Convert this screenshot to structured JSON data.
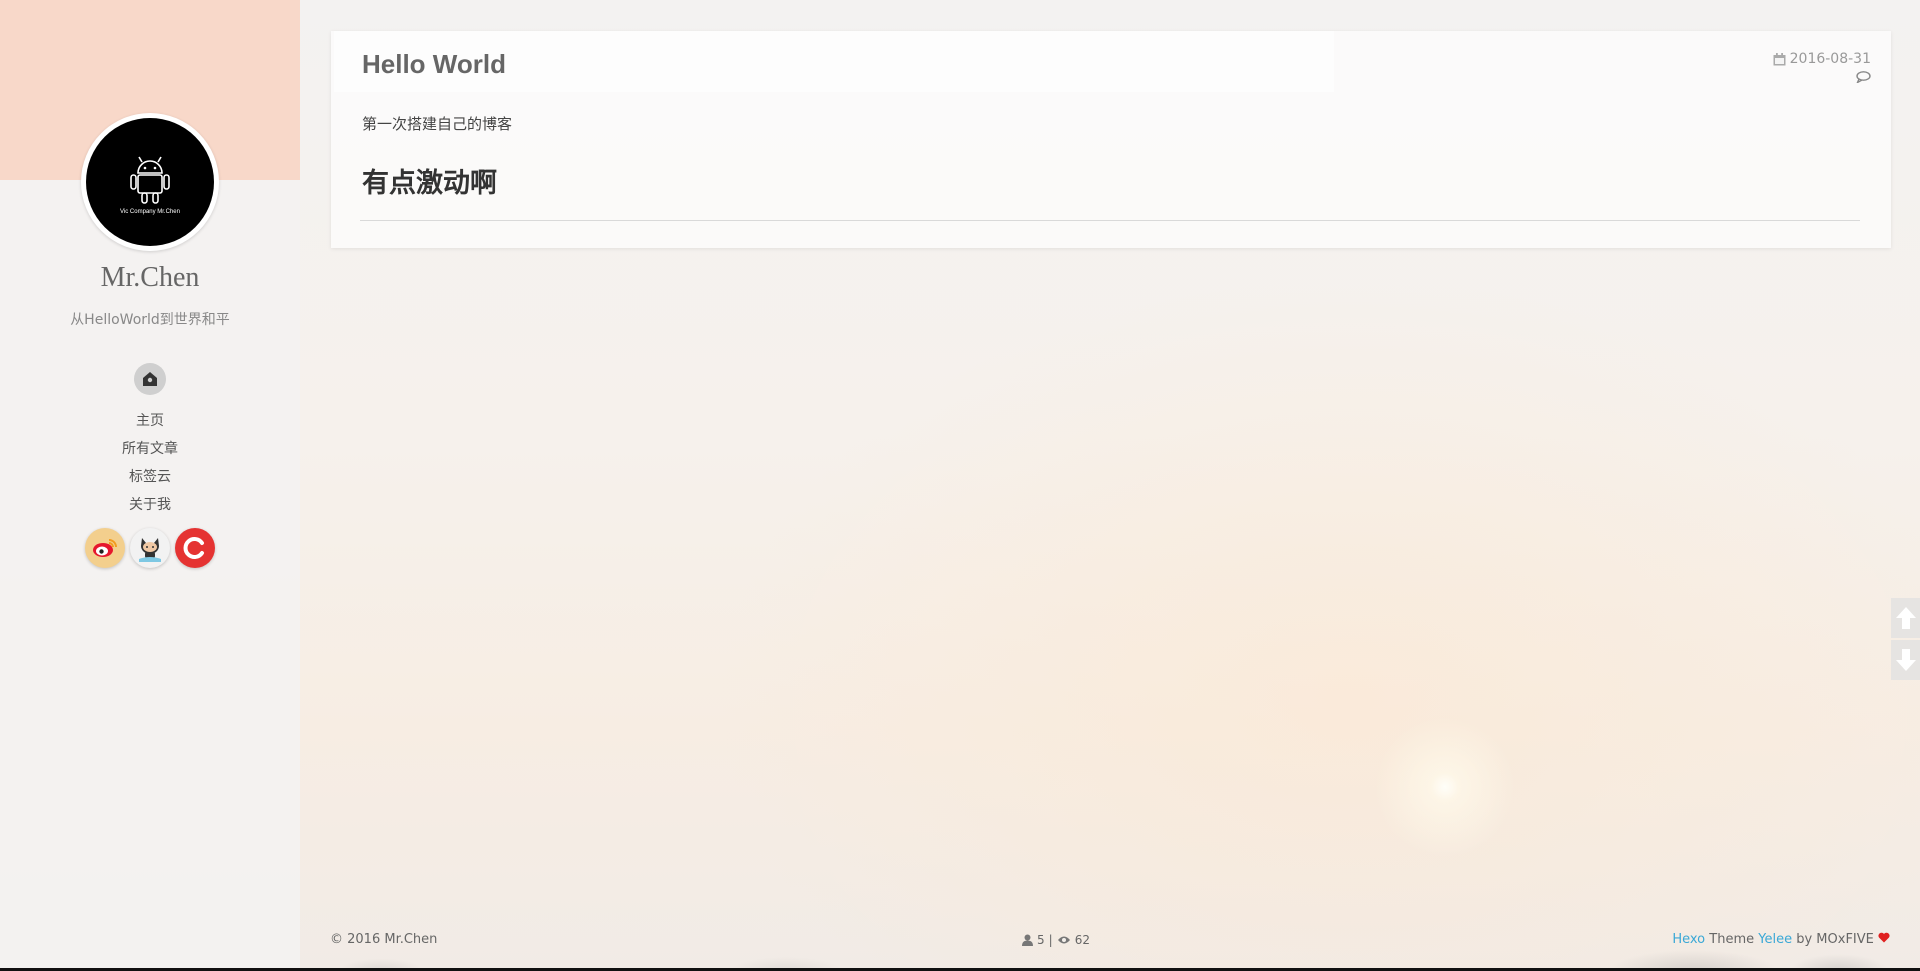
{
  "sidebar": {
    "avatar_caption": "Vic Company Mr.Chen",
    "site_name": "Mr.Chen",
    "site_description": "从HelloWorld到世界和平",
    "home_icon": "home-icon",
    "nav": [
      {
        "label": "主页"
      },
      {
        "label": "所有文章"
      },
      {
        "label": "标签云"
      },
      {
        "label": "关于我"
      }
    ],
    "social": [
      {
        "icon": "weibo-icon"
      },
      {
        "icon": "github-icon"
      },
      {
        "icon": "csdn-icon"
      }
    ]
  },
  "post": {
    "title": "Hello World",
    "date": "2016-08-31",
    "intro": "第一次搭建自己的博客",
    "heading": "有点激动啊"
  },
  "footer": {
    "copyright": "© 2016 Mr.Chen",
    "visitors": "5",
    "separator": "|",
    "views": "62",
    "credit_hexo": "Hexo",
    "credit_theme": "Theme",
    "credit_yelee": "Yelee",
    "credit_by": "by MOxFIVE",
    "heart_color": "#e02020"
  },
  "colors": {
    "accent_link": "#3aa8d6",
    "sidebar_cover": "#f8d8c9"
  }
}
